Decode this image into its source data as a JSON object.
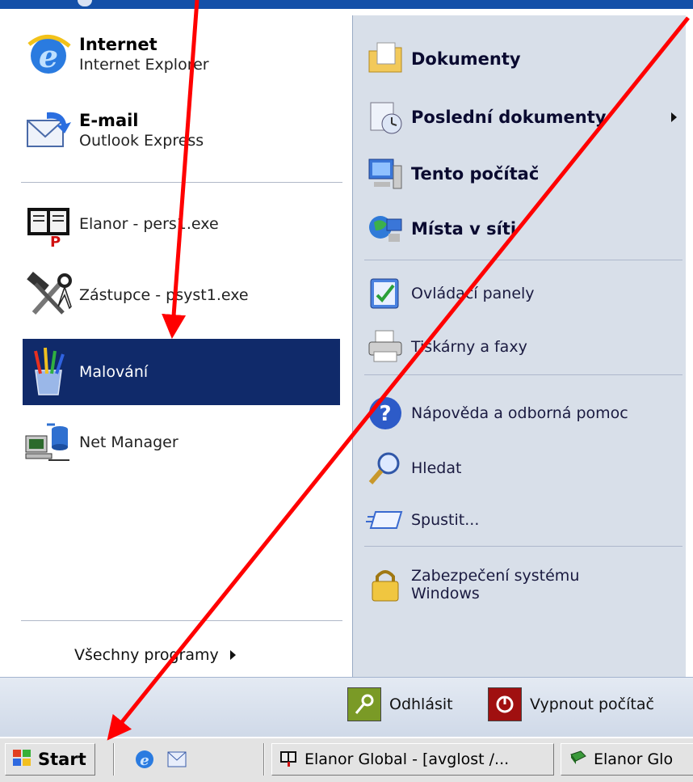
{
  "start_menu": {
    "pinned": [
      {
        "title": "Internet",
        "subtitle": "Internet Explorer",
        "icon": "internet-explorer-icon"
      },
      {
        "title": "E-mail",
        "subtitle": "Outlook Express",
        "icon": "outlook-express-icon"
      }
    ],
    "recent": [
      {
        "label": "Elanor - pers1.exe",
        "icon": "elanor-book-icon"
      },
      {
        "label": "Zástupce - psyst1.exe",
        "icon": "hammer-wrench-icon"
      },
      {
        "label": "Malování",
        "icon": "paint-brushes-icon"
      },
      {
        "label": "Net Manager",
        "icon": "network-computer-icon"
      }
    ],
    "all_programs": "Všechny programy",
    "right": [
      {
        "label": "Dokumenty",
        "bold": true
      },
      {
        "label": "Poslední dokumenty",
        "bold": true
      },
      {
        "label": "Tento počítač",
        "bold": true
      },
      {
        "label": "Místa v síti",
        "bold": true
      },
      {
        "label": "Ovládací panely"
      },
      {
        "label": "Tiskárny a faxy"
      },
      {
        "label": "Nápověda a odborná pomoc"
      },
      {
        "label": "Hledat"
      },
      {
        "label": "Spustit..."
      },
      {
        "label": "Zabezpečení systému",
        "label2": "Windows"
      }
    ],
    "logoff": "Odhlásit",
    "shutdown": "Vypnout počítač"
  },
  "taskbar": {
    "start": "Start",
    "tasks": [
      "Elanor Global - [avglost /...",
      "Elanor Glo"
    ]
  },
  "colors": {
    "selection": "#102a6a",
    "arrow": "#ff0000"
  }
}
